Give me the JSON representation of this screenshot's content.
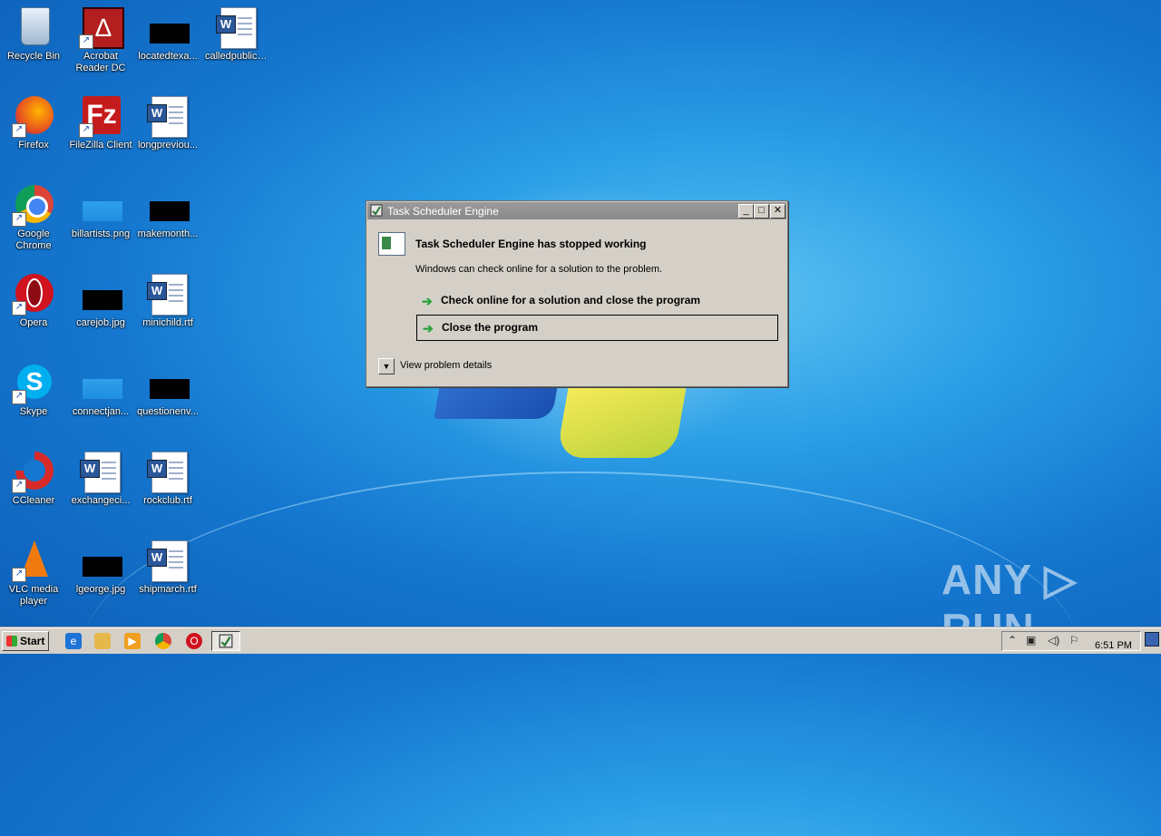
{
  "desktop": {
    "icons": [
      {
        "label": "Recycle Bin"
      },
      {
        "label": "Acrobat Reader DC"
      },
      {
        "label": "locatedtexa..."
      },
      {
        "label": "calledpublic.rtf"
      },
      {
        "label": "Firefox"
      },
      {
        "label": "FileZilla Client"
      },
      {
        "label": "longpreviou..."
      },
      {
        "label": "Google Chrome"
      },
      {
        "label": "billartists.png"
      },
      {
        "label": "makemonth..."
      },
      {
        "label": "Opera"
      },
      {
        "label": "carejob.jpg"
      },
      {
        "label": "minichild.rtf"
      },
      {
        "label": "Skype"
      },
      {
        "label": "connectjan..."
      },
      {
        "label": "questionenv..."
      },
      {
        "label": "CCleaner"
      },
      {
        "label": "exchangeci..."
      },
      {
        "label": "rockclub.rtf"
      },
      {
        "label": "VLC media player"
      },
      {
        "label": "lgeorge.jpg"
      },
      {
        "label": "shipmarch.rtf"
      }
    ]
  },
  "dialog": {
    "title": "Task Scheduler Engine",
    "headline": "Task Scheduler Engine has stopped working",
    "message": "Windows can check online for a solution to the problem.",
    "actions": [
      {
        "label": "Check online for a solution and close the program",
        "selected": false
      },
      {
        "label": "Close the program",
        "selected": true
      }
    ],
    "details_label": "View problem details",
    "title_buttons": {
      "minimize": "_",
      "maximize": "□",
      "close": "✕"
    }
  },
  "taskbar": {
    "start_label": "Start",
    "clock": "6:51 PM",
    "pinned": [
      "internet-explorer-icon",
      "explorer-icon",
      "media-player-icon",
      "chrome-icon",
      "opera-icon",
      "task-scheduler-icon"
    ]
  },
  "watermark": "ANY ▷ RUN",
  "colors": {
    "accent": "#2aa33a",
    "taskbar": "#d4d0c8",
    "titlebar": "#8a8a8a"
  }
}
